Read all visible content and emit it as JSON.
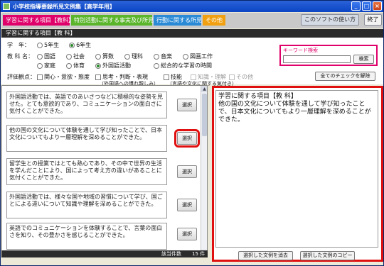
{
  "window": {
    "title": "小学校指導要録所見文例集【高学年用】",
    "close_label": "×",
    "min_label": "_",
    "max_label": "□"
  },
  "tabs": [
    {
      "label": "学習に関する項目【教科】"
    },
    {
      "label": "特別活動に関する事実及び所見"
    },
    {
      "label": "行動に関する所見"
    },
    {
      "label": "その他"
    }
  ],
  "header_buttons": {
    "howto": "このソフトの使い方",
    "exit": "終了"
  },
  "section_title": "学習に関する項目【教 科】",
  "filters": {
    "grade_label": "学　年：",
    "grades": [
      {
        "label": "5年生",
        "selected": false
      },
      {
        "label": "6年生",
        "selected": true
      }
    ],
    "subject_label": "教 科 名：",
    "subjects_row1": [
      {
        "label": "国語",
        "selected": false
      },
      {
        "label": "社会",
        "selected": false
      },
      {
        "label": "算数",
        "selected": false
      },
      {
        "label": "理科",
        "selected": false
      },
      {
        "label": "音楽",
        "selected": false
      },
      {
        "label": "図画工作",
        "selected": false
      }
    ],
    "subjects_row2": [
      {
        "label": "家庭",
        "selected": false
      },
      {
        "label": "体育",
        "selected": false
      },
      {
        "label": "外国語活動",
        "selected": true
      },
      {
        "label": "総合的な学習の時間",
        "selected": false
      }
    ],
    "viewpoint_label": "評価観点：",
    "viewpoints": [
      {
        "label": "関心・意欲・態度",
        "disabled": false
      },
      {
        "label": "思考・判断・表現",
        "disabled": false
      },
      {
        "label": "技能",
        "disabled": false
      },
      {
        "label": "知識・理解",
        "disabled": true
      },
      {
        "label": "その他",
        "disabled": true
      }
    ],
    "viewpoint_note_1": "（外国語への慣れ親しみ）",
    "viewpoint_note_2": "（言語や文化に関する気付き）",
    "keyword": {
      "title": "キーワード検索",
      "value": "",
      "button": "検索"
    },
    "release_all": "全てのチェックを解除"
  },
  "list": {
    "select_label": "選択",
    "items": [
      {
        "text": "外国語活動では、英語でのあいさつなどに積極的な姿勢を見せた。とても意欲的であり、コミュニケーションの面白さに気付くことができた。"
      },
      {
        "text": "他の国の文化について体験を通して学び知ったことで、日本文化についてもより一層理解を深めることができた。"
      },
      {
        "text": "留学生との授業ではとても熱心であり、その中で世界の生活を学んだことにより、国によって考え方の違いがあることに気付くことができた。"
      },
      {
        "text": "外国語活動では、様々な国や地域の習慣について学び、国ごとによる違いについて知識や理解を深めることができた。"
      },
      {
        "text": "英語でのコミュニケーションを体験することで、言葉の面白さを知り、その豊かさを感じることができた。"
      }
    ],
    "highlighted_index": 1,
    "count_label": "該当件数",
    "count_value": "15 件"
  },
  "output": {
    "text": "学習に関する項目【教 科】\n他の国の文化について体験を通して学び知ったことで、日本文化についてもより一層理解を深めることができた。",
    "clear_button": "選択した文例を消去",
    "copy_button": "選択した文例のコピー"
  },
  "colors": {
    "tab1": "#e0006a",
    "tab2": "#5ab52b",
    "tab3": "#2a8ad6",
    "tab4": "#f0a010",
    "highlight": "#e01010"
  }
}
